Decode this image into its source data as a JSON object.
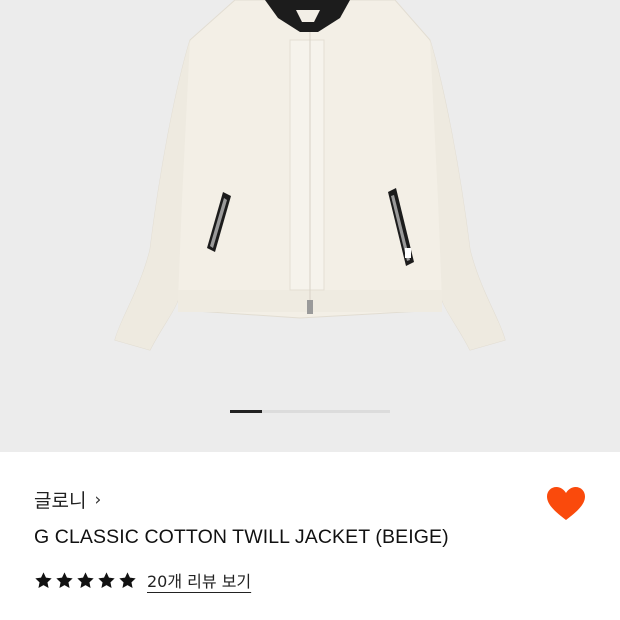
{
  "gallery": {
    "image_alt": "jacket-product-photo",
    "page_indicator": {
      "current": 1,
      "total": 5
    }
  },
  "product": {
    "brand": "글로니",
    "brand_chevron": "›",
    "title": "G CLASSIC COTTON TWILL JACKET (BEIGE)",
    "rating": 5,
    "rating_max": 5,
    "review_link": "20개 리뷰 보기",
    "favorite": true
  },
  "colors": {
    "heart": "#fa4a0c",
    "jacket": "#f3efe6",
    "collar": "#1c1c1c"
  },
  "icons": {
    "heart": "heart-icon",
    "star": "star-icon",
    "chevron": "chevron-right-icon"
  }
}
